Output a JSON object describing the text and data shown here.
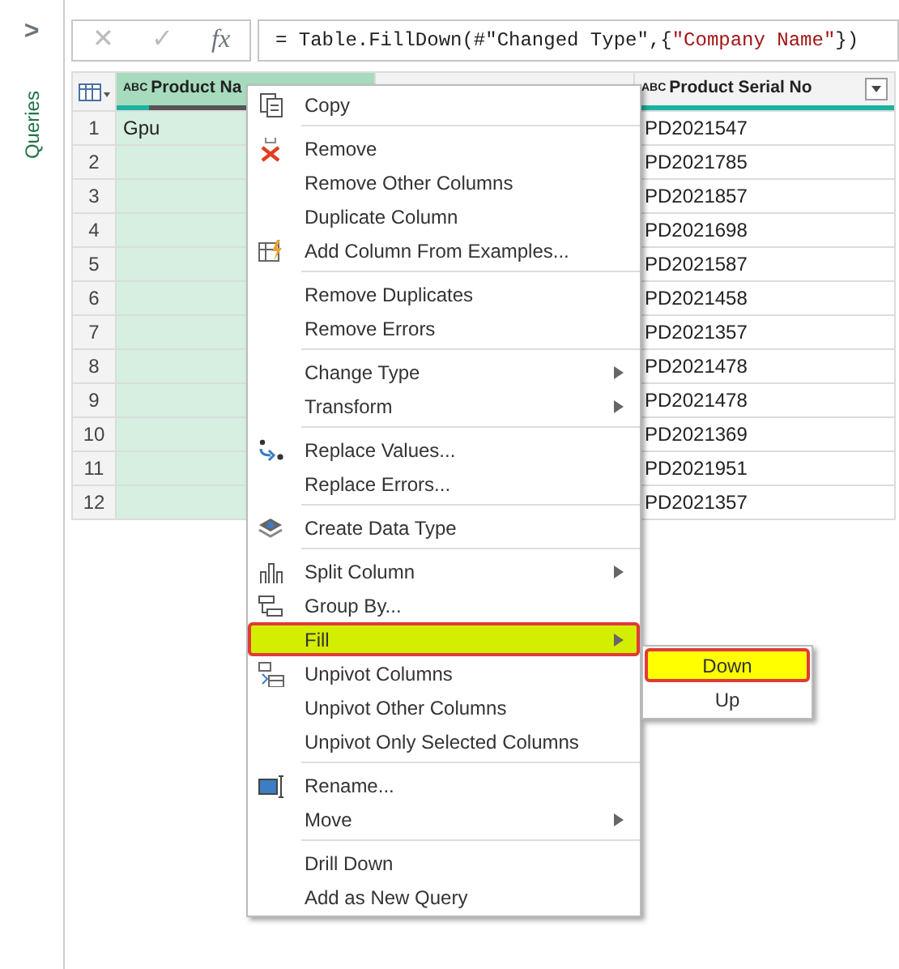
{
  "sidebar": {
    "expand_glyph": ">",
    "label": "Queries"
  },
  "formula_bar": {
    "cancel": "✕",
    "confirm": "✓",
    "fx": "fx",
    "formula": [
      {
        "kind": "code",
        "text": "= Table.FillDown(#\"Changed Type\",{"
      },
      {
        "kind": "string",
        "text": "\"Company Name\""
      },
      {
        "kind": "code",
        "text": "})"
      }
    ]
  },
  "table": {
    "columns": [
      {
        "type_glyph": "ABC",
        "label": "Product Na",
        "selected": true
      },
      {
        "type_glyph": "ABC",
        "label": "Product Serial No",
        "selected": false
      }
    ],
    "rows": [
      {
        "number": "1",
        "cells": [
          "Gpu",
          "PD2021547"
        ]
      },
      {
        "number": "2",
        "cells": [
          "",
          "PD2021785"
        ]
      },
      {
        "number": "3",
        "cells": [
          "",
          "PD2021857"
        ]
      },
      {
        "number": "4",
        "cells": [
          "",
          "PD2021698"
        ]
      },
      {
        "number": "5",
        "cells": [
          "",
          "PD2021587"
        ]
      },
      {
        "number": "6",
        "cells": [
          "",
          "PD2021458"
        ]
      },
      {
        "number": "7",
        "cells": [
          "",
          "PD2021357"
        ]
      },
      {
        "number": "8",
        "cells": [
          "",
          "PD2021478"
        ]
      },
      {
        "number": "9",
        "cells": [
          "",
          "PD2021478"
        ]
      },
      {
        "number": "10",
        "cells": [
          "",
          "PD2021369"
        ]
      },
      {
        "number": "11",
        "cells": [
          "",
          "PD2021951"
        ]
      },
      {
        "number": "12",
        "cells": [
          "",
          "PD2021357"
        ]
      }
    ]
  },
  "context_menu": {
    "items": [
      {
        "kind": "item",
        "label": "Copy",
        "submenu": false,
        "selected": false
      },
      {
        "kind": "separator"
      },
      {
        "kind": "item",
        "label": "Remove",
        "submenu": false,
        "selected": false
      },
      {
        "kind": "item",
        "label": "Remove Other Columns",
        "submenu": false,
        "selected": false
      },
      {
        "kind": "item",
        "label": "Duplicate Column",
        "submenu": false,
        "selected": false
      },
      {
        "kind": "item",
        "label": "Add Column From Examples...",
        "submenu": false,
        "selected": false
      },
      {
        "kind": "separator"
      },
      {
        "kind": "item",
        "label": "Remove Duplicates",
        "submenu": false,
        "selected": false
      },
      {
        "kind": "item",
        "label": "Remove Errors",
        "submenu": false,
        "selected": false
      },
      {
        "kind": "separator"
      },
      {
        "kind": "item",
        "label": "Change Type",
        "submenu": true,
        "selected": false
      },
      {
        "kind": "item",
        "label": "Transform",
        "submenu": true,
        "selected": false
      },
      {
        "kind": "separator"
      },
      {
        "kind": "item",
        "label": "Replace Values...",
        "submenu": false,
        "selected": false
      },
      {
        "kind": "item",
        "label": "Replace Errors...",
        "submenu": false,
        "selected": false
      },
      {
        "kind": "separator"
      },
      {
        "kind": "item",
        "label": "Create Data Type",
        "submenu": false,
        "selected": false
      },
      {
        "kind": "separator"
      },
      {
        "kind": "item",
        "label": "Split Column",
        "submenu": true,
        "selected": false
      },
      {
        "kind": "item",
        "label": "Group By...",
        "submenu": false,
        "selected": false
      },
      {
        "kind": "item",
        "label": "Fill",
        "submenu": true,
        "selected": true
      },
      {
        "kind": "item",
        "label": "Unpivot Columns",
        "submenu": false,
        "selected": false
      },
      {
        "kind": "item",
        "label": "Unpivot Other Columns",
        "submenu": false,
        "selected": false
      },
      {
        "kind": "item",
        "label": "Unpivot Only Selected Columns",
        "submenu": false,
        "selected": false
      },
      {
        "kind": "separator"
      },
      {
        "kind": "item",
        "label": "Rename...",
        "submenu": false,
        "selected": false
      },
      {
        "kind": "item",
        "label": "Move",
        "submenu": true,
        "selected": false
      },
      {
        "kind": "separator"
      },
      {
        "kind": "item",
        "label": "Drill Down",
        "submenu": false,
        "selected": false
      },
      {
        "kind": "item",
        "label": "Add as New Query",
        "submenu": false,
        "selected": false
      }
    ]
  },
  "submenu": {
    "items": [
      {
        "label": "Down",
        "selected": true
      },
      {
        "label": "Up",
        "selected": false
      }
    ]
  }
}
